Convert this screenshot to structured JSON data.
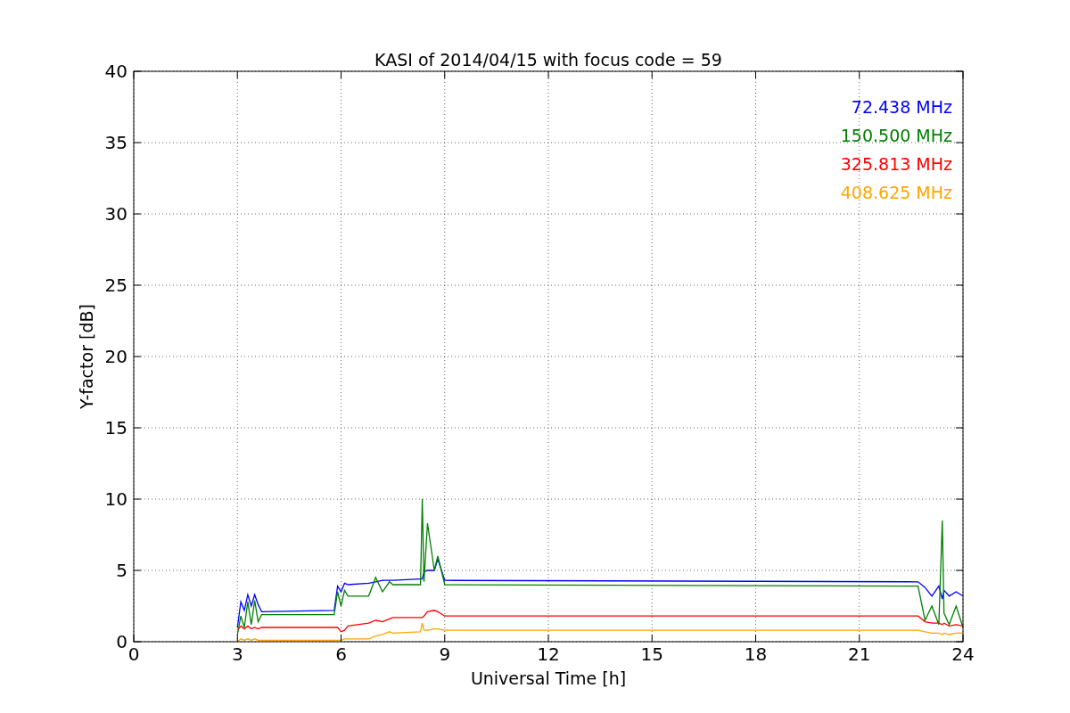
{
  "figure": {
    "chart_data": {
      "type": "line",
      "title": "KASI of 2014/04/15 with focus code = 59",
      "xlabel": "Universal Time [h]",
      "ylabel": "Y-factor [dB]",
      "x": [
        3.0,
        3.1,
        3.2,
        3.3,
        3.4,
        3.5,
        3.6,
        3.7,
        5.8,
        5.9,
        6.0,
        6.1,
        6.2,
        6.8,
        7.0,
        7.2,
        7.4,
        7.5,
        8.3,
        8.35,
        8.4,
        8.5,
        8.7,
        8.8,
        9.0,
        22.7,
        22.9,
        23.1,
        23.3,
        23.4,
        23.45,
        23.6,
        23.8,
        24.0
      ],
      "series": [
        {
          "name": "72.438 MHz",
          "color": "#0000ff",
          "values": [
            1.0,
            2.8,
            2.2,
            3.3,
            2.5,
            3.3,
            2.6,
            2.1,
            2.2,
            3.9,
            3.5,
            4.1,
            4.0,
            4.1,
            4.2,
            4.3,
            4.3,
            4.3,
            4.4,
            4.4,
            4.9,
            5.0,
            5.0,
            5.8,
            4.3,
            4.2,
            3.8,
            3.2,
            3.9,
            3.0,
            3.6,
            3.2,
            3.5,
            3.2
          ]
        },
        {
          "name": "150.500 MHz",
          "color": "#008000",
          "values": [
            0.5,
            1.8,
            1.0,
            2.8,
            1.2,
            2.9,
            1.4,
            1.9,
            1.9,
            3.5,
            2.5,
            3.6,
            3.2,
            3.2,
            4.5,
            3.5,
            4.2,
            4.0,
            4.0,
            10.0,
            4.2,
            8.3,
            5.0,
            6.0,
            4.0,
            3.9,
            1.5,
            2.5,
            1.2,
            8.5,
            2.0,
            1.2,
            2.5,
            1.0
          ]
        },
        {
          "name": "325.813 MHz",
          "color": "#ff0000",
          "values": [
            0.8,
            1.1,
            0.9,
            1.1,
            0.9,
            1.0,
            0.9,
            1.0,
            1.0,
            1.0,
            0.7,
            0.8,
            1.1,
            1.3,
            1.5,
            1.4,
            1.6,
            1.7,
            1.7,
            1.7,
            1.8,
            2.1,
            2.2,
            2.1,
            1.8,
            1.8,
            1.4,
            1.3,
            1.3,
            1.2,
            1.3,
            1.1,
            1.2,
            1.1
          ]
        },
        {
          "name": "408.625 MHz",
          "color": "#ffa500",
          "values": [
            0.0,
            0.2,
            0.1,
            0.2,
            0.1,
            0.2,
            0.1,
            0.1,
            0.1,
            0.1,
            0.1,
            0.2,
            0.2,
            0.2,
            0.4,
            0.5,
            0.7,
            0.6,
            0.7,
            1.3,
            0.8,
            0.8,
            0.9,
            0.9,
            0.8,
            0.8,
            0.7,
            0.6,
            0.6,
            0.5,
            0.6,
            0.5,
            0.6,
            0.6
          ]
        }
      ],
      "xlim": [
        0,
        24
      ],
      "ylim": [
        0,
        40
      ],
      "xticks": [
        0,
        3,
        6,
        9,
        12,
        15,
        18,
        21,
        24
      ],
      "yticks": [
        0,
        5,
        10,
        15,
        20,
        25,
        30,
        35,
        40
      ],
      "grid": true
    }
  }
}
